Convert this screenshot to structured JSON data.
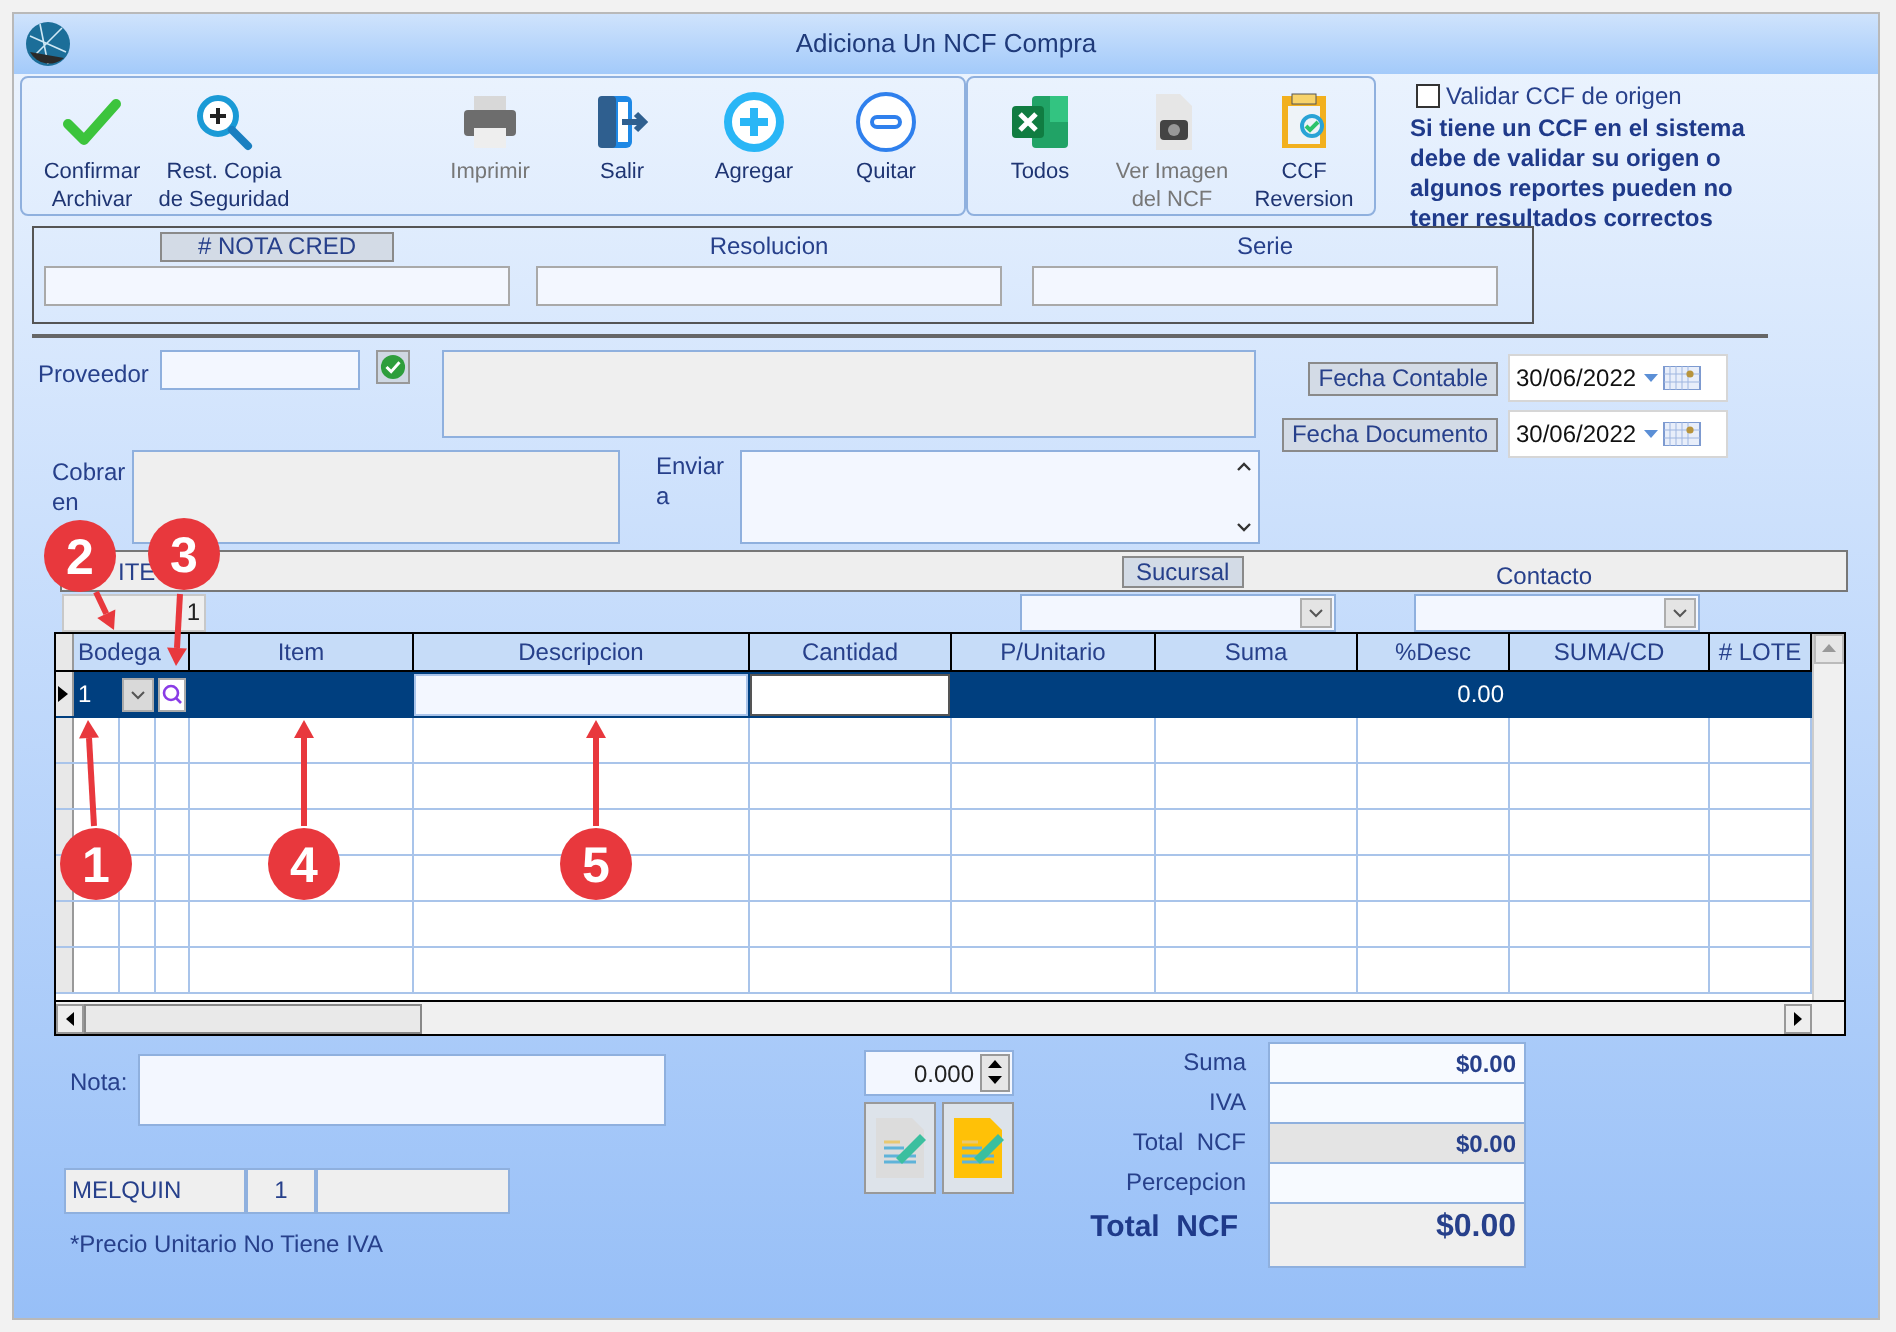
{
  "window": {
    "title": "Adiciona Un NCF Compra"
  },
  "toolbar": [
    [
      {
        "label": "Confirmar\nArchivar",
        "kind": "check",
        "disabled": false
      },
      {
        "label": "Rest. Copia\nde Seguridad",
        "kind": "zoom",
        "disabled": false
      },
      {
        "label": "Imprimir",
        "kind": "printer",
        "disabled": true
      },
      {
        "label": "Salir",
        "kind": "exit",
        "disabled": false
      },
      {
        "label": "Agregar",
        "kind": "plus",
        "disabled": false
      },
      {
        "label": "Quitar",
        "kind": "minus",
        "disabled": false
      }
    ],
    [
      {
        "label": "Todos",
        "kind": "sheet",
        "disabled": false
      },
      {
        "label": "Ver Imagen\ndel NCF",
        "kind": "camera",
        "disabled": true
      },
      {
        "label": "CCF\nReversion",
        "kind": "reversal",
        "disabled": false
      }
    ]
  ],
  "validation": {
    "label": "Validar CCF de origen",
    "checked": false,
    "note": "Si tiene un CCF en el sistema\ndebe de validar su origen o\nalgunos reportes pueden no\ntener resultados correctos"
  },
  "document_fields": [
    {
      "label": "# NOTA CRED",
      "boxed": true
    },
    {
      "label": "Resolucion",
      "boxed": false
    },
    {
      "label": "Serie",
      "boxed": false
    }
  ],
  "supplier": {
    "label": "Proveedor"
  },
  "dates": [
    {
      "label": "Fecha Contable",
      "value": "30/06/2022"
    },
    {
      "label": "Fecha Documento",
      "value": "30/06/2022"
    }
  ],
  "charge_to": {
    "label": "Cobrar\nen"
  },
  "send_to": {
    "label": "Enviar\na"
  },
  "items_strip": {
    "label": "ITE",
    "count": "1",
    "branch": "Sucursal",
    "contact": "Contacto"
  },
  "grid": {
    "columns": [
      "Bodega",
      "Item",
      "Descripcion",
      "Cantidad",
      "P/Unitario",
      "Suma",
      "%Desc",
      "SUMA/CD",
      "# LOTE"
    ],
    "rows": [
      {
        "selected": true,
        "bodega": "1",
        "pct_desc": "0.00"
      }
    ]
  },
  "note": {
    "label": "Nota:"
  },
  "quantity": "0.000",
  "totals": [
    {
      "label": "Suma",
      "value": "$0.00",
      "shaded": false
    },
    {
      "label": "IVA",
      "shaded": false
    },
    {
      "label": "Total  NCF",
      "value": "$0.00",
      "shaded": true
    },
    {
      "label": "Percepcion",
      "shaded": false
    }
  ],
  "grand_total": {
    "label": "Total  NCF",
    "value": "$0.00"
  },
  "user_bar": [
    "MELQUIN",
    "1"
  ],
  "footnote": "*Precio Unitario No Tiene IVA",
  "callouts": [
    {
      "label": "2"
    },
    {
      "label": "3"
    },
    {
      "label": "1"
    },
    {
      "label": "4"
    },
    {
      "label": "5"
    }
  ]
}
